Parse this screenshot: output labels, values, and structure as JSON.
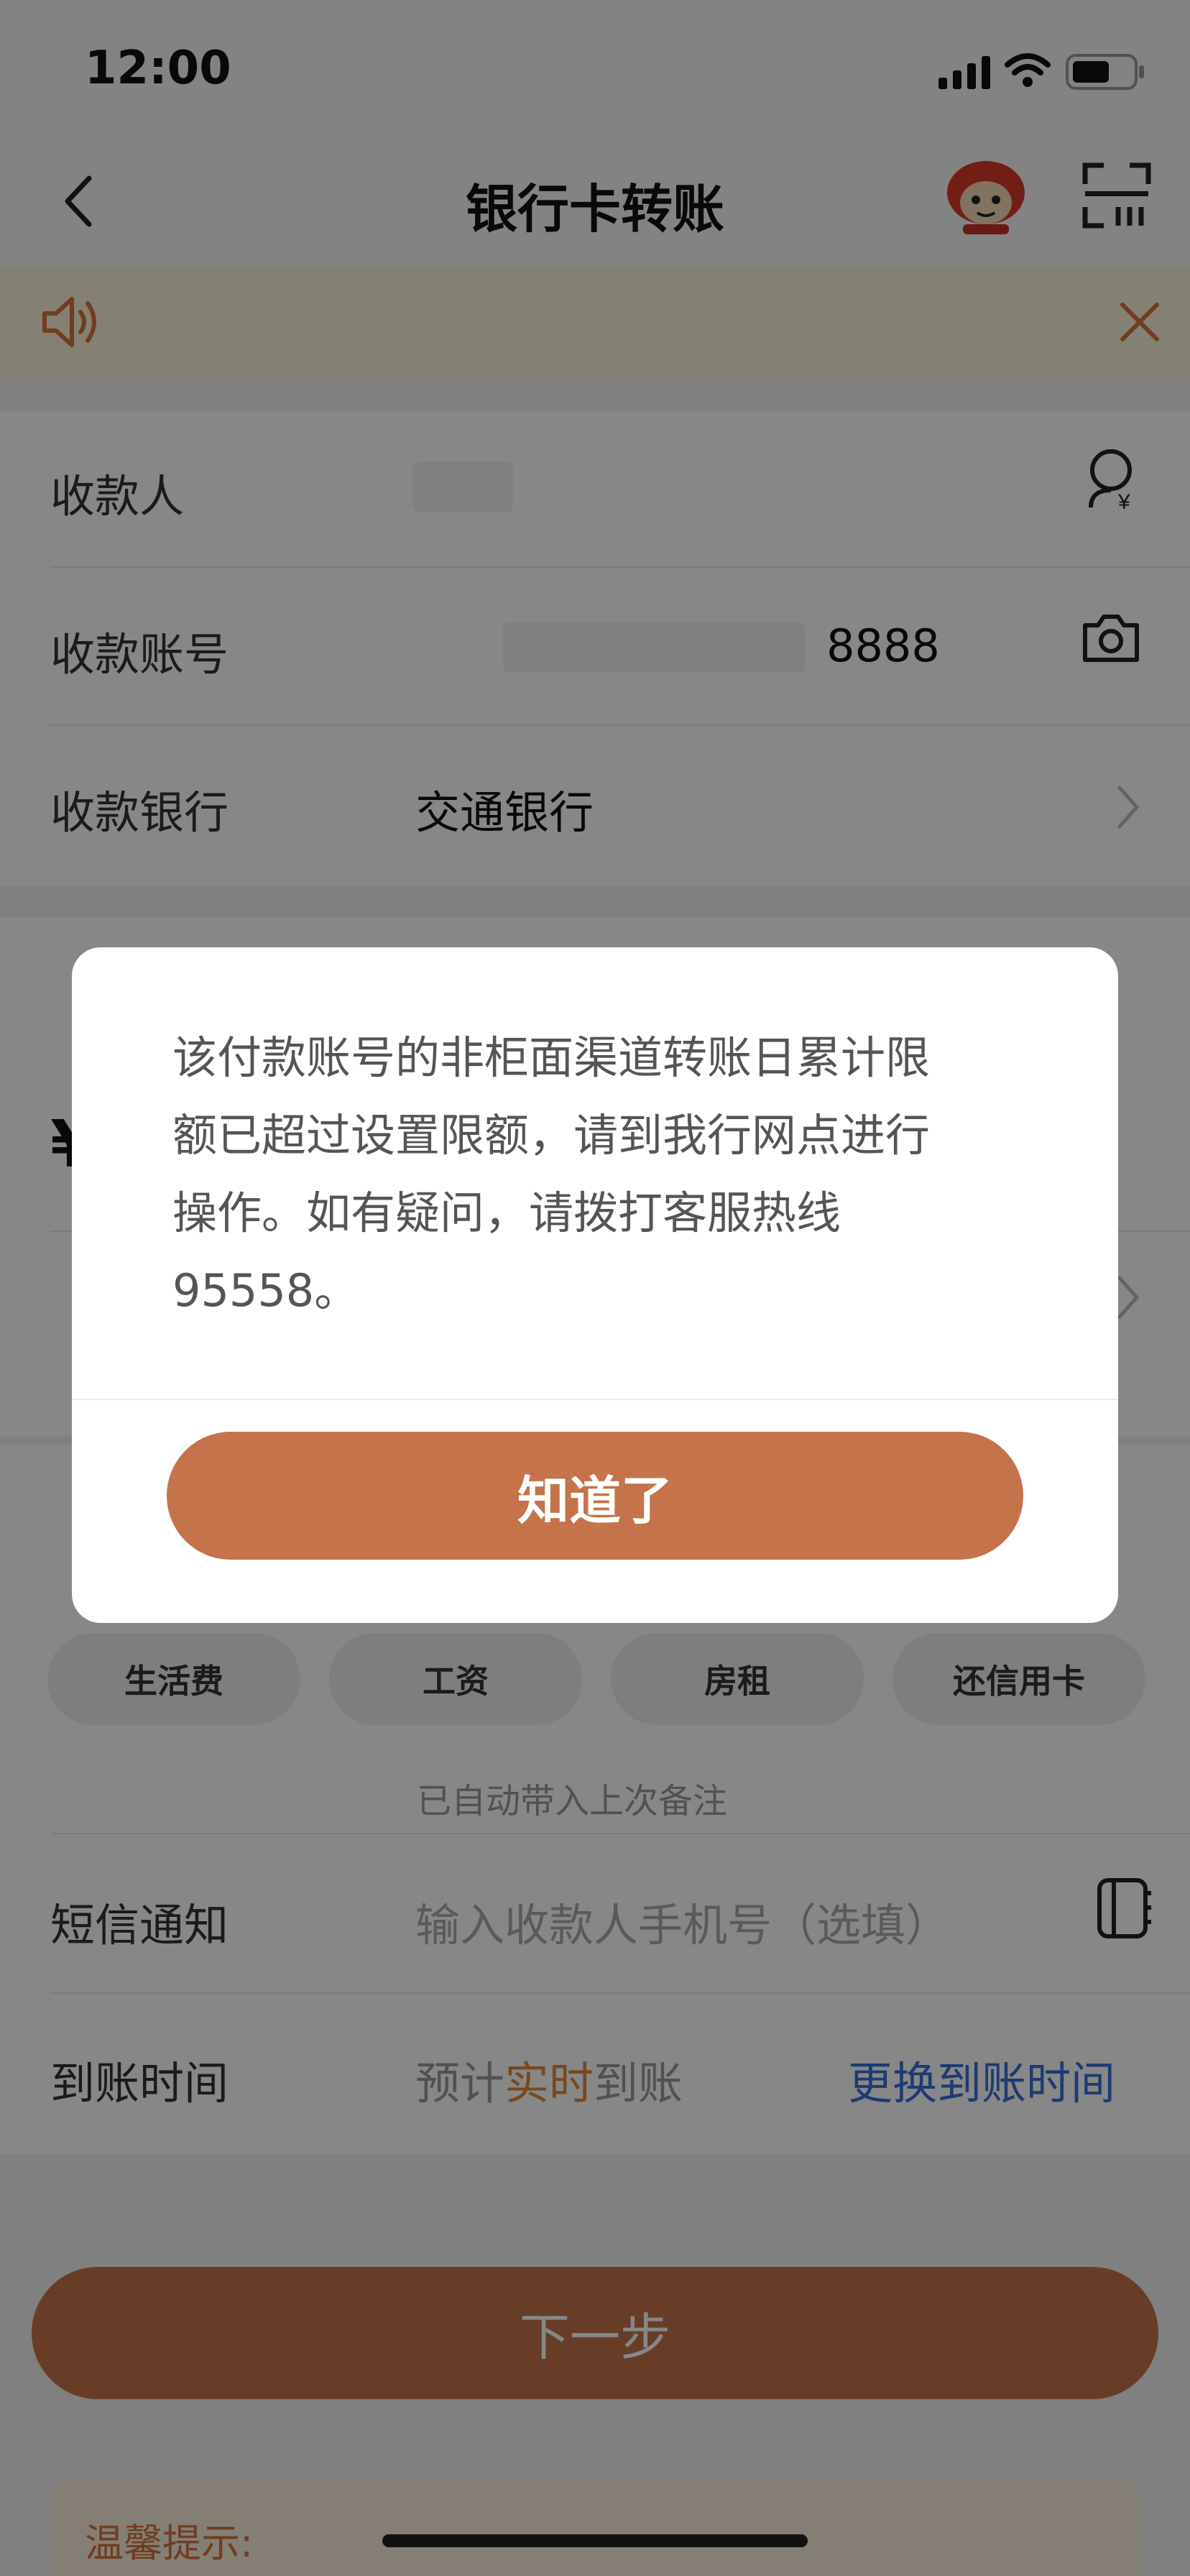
{
  "status_bar": {
    "time": "12:00"
  },
  "nav": {
    "title": "银行卡转账"
  },
  "form": {
    "payee_label": "收款人",
    "account_label": "收款账号",
    "account_value": "8888",
    "bank_label": "收款银行",
    "bank_value": "交通银行",
    "amount_symbol": "¥"
  },
  "remark": {
    "chips": [
      "生活费",
      "工资",
      "房租",
      "还信用卡"
    ],
    "hint": "已自动带入上次备注"
  },
  "sms": {
    "label": "短信通知",
    "placeholder": "输入收款人手机号（选填）"
  },
  "arrival": {
    "label": "到账时间",
    "prefix": "预计",
    "highlight": "实时",
    "suffix": "到账",
    "change_link": "更换到账时间"
  },
  "next_button": "下一步",
  "tips": {
    "title": "温馨提示:"
  },
  "dialog": {
    "line1": "该付款账号的非柜面渠道转账日累计限",
    "line2": "额已超过设置限额，请到我行网点进行",
    "line3": "操作。如有疑问，请拨打客服热线",
    "line4": "95558。",
    "button": "知道了"
  },
  "colors": {
    "brand": "#c4734a",
    "link": "#3a6fd8",
    "highlight": "#e0883c"
  }
}
